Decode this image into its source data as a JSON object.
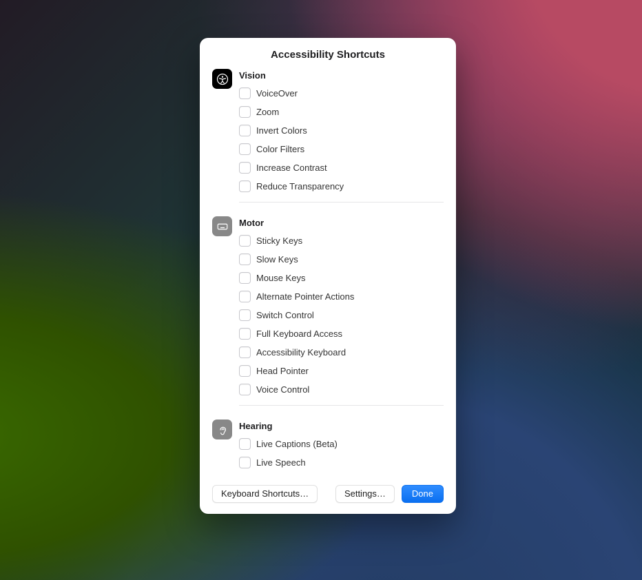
{
  "title": "Accessibility Shortcuts",
  "sections": [
    {
      "icon": "accessibility-icon",
      "heading": "Vision",
      "items": [
        {
          "label": "VoiceOver"
        },
        {
          "label": "Zoom"
        },
        {
          "label": "Invert Colors"
        },
        {
          "label": "Color Filters"
        },
        {
          "label": "Increase Contrast"
        },
        {
          "label": "Reduce Transparency"
        }
      ]
    },
    {
      "icon": "keyboard-icon",
      "heading": "Motor",
      "items": [
        {
          "label": "Sticky Keys"
        },
        {
          "label": "Slow Keys"
        },
        {
          "label": "Mouse Keys"
        },
        {
          "label": "Alternate Pointer Actions"
        },
        {
          "label": "Switch Control"
        },
        {
          "label": "Full Keyboard Access"
        },
        {
          "label": "Accessibility Keyboard"
        },
        {
          "label": "Head Pointer"
        },
        {
          "label": "Voice Control"
        }
      ]
    },
    {
      "icon": "ear-icon",
      "heading": "Hearing",
      "items": [
        {
          "label": "Live Captions (Beta)"
        },
        {
          "label": "Live Speech"
        }
      ]
    }
  ],
  "buttons": {
    "keyboard": "Keyboard Shortcuts…",
    "settings": "Settings…",
    "done": "Done"
  }
}
